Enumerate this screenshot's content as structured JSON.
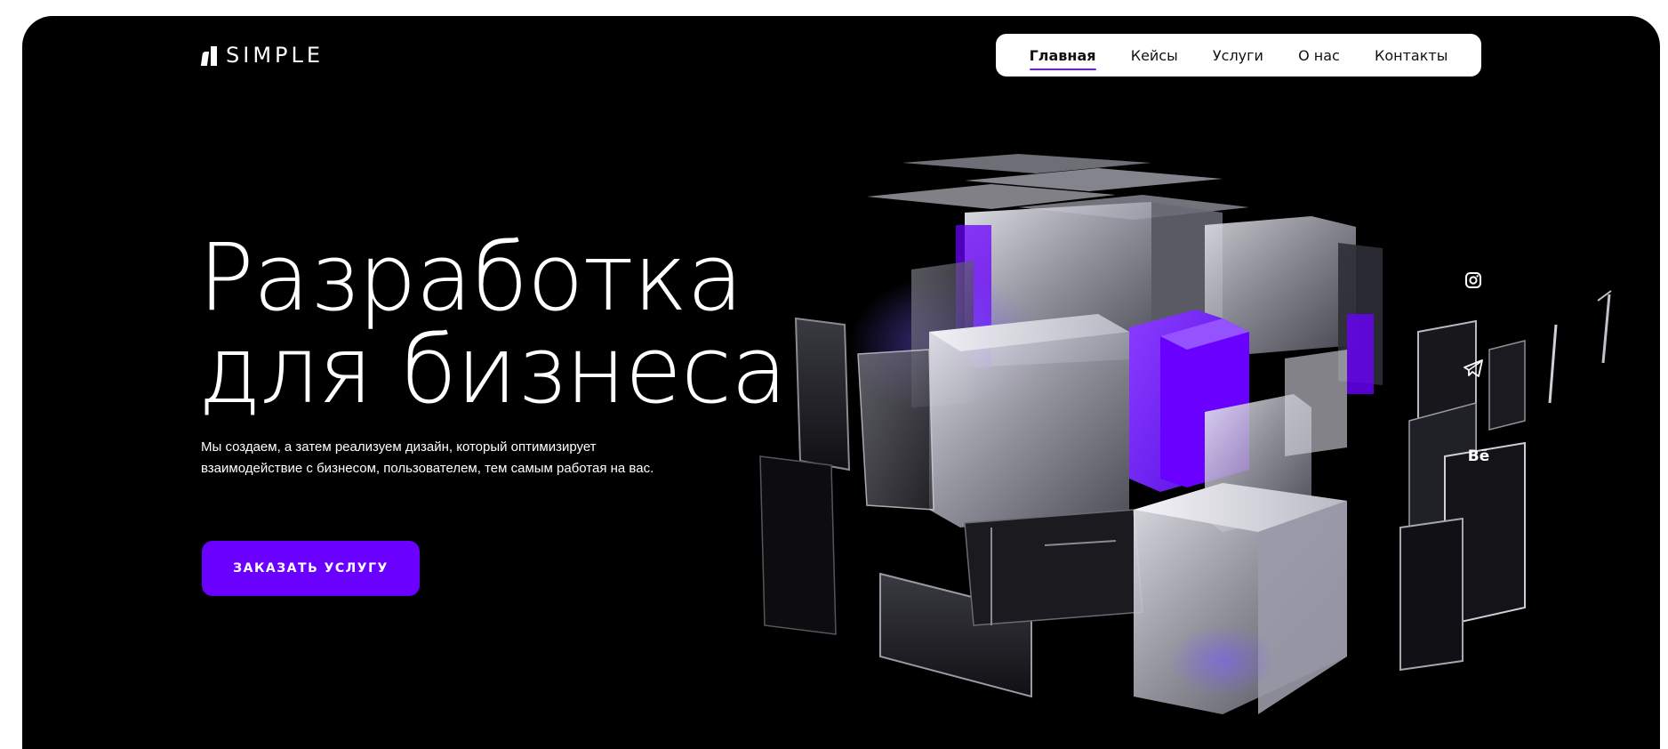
{
  "brand": {
    "name": "SIMPLE",
    "accent_color": "#6a00ff",
    "background_color": "#000000"
  },
  "nav": {
    "items": [
      {
        "label": "Главная",
        "active": true
      },
      {
        "label": "Кейсы",
        "active": false
      },
      {
        "label": "Услуги",
        "active": false
      },
      {
        "label": "О нас",
        "active": false
      },
      {
        "label": "Контакты",
        "active": false
      }
    ]
  },
  "hero": {
    "title_line1": "Разработка",
    "title_line2": "для бизнеса",
    "description_line1": "Мы создаем, а затем реализуем дизайн, который оптимизирует",
    "description_line2": "взаимодействие с бизнесом, пользователем, тем самым работая на вас.",
    "cta_label": "ЗАКАЗАТЬ УСЛУГУ"
  },
  "social": {
    "icons": [
      "instagram-icon",
      "telegram-icon",
      "behance-icon"
    ],
    "behance_label": "Bē"
  }
}
